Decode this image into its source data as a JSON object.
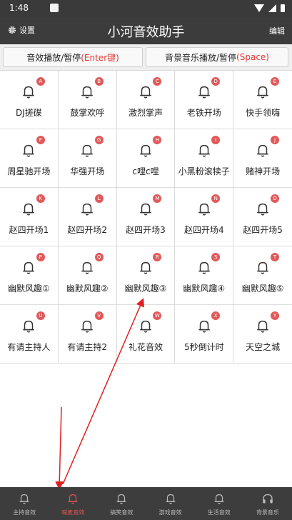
{
  "status_bar": {
    "time": "1:48"
  },
  "header": {
    "settings_label": "设置",
    "title": "小河音效助手",
    "edit_label": "编辑"
  },
  "top_buttons": {
    "left": {
      "text": "音效播放/暂停",
      "key": "(Enter键)"
    },
    "right": {
      "text": "背景音乐播放/暂停",
      "key": "(Space)"
    }
  },
  "grid": {
    "rows": [
      [
        {
          "label": "DJ搓碟",
          "badge": "A"
        },
        {
          "label": "鼓掌欢呼",
          "badge": "B"
        },
        {
          "label": "激烈掌声",
          "badge": "C"
        },
        {
          "label": "老铁开场",
          "badge": "D"
        },
        {
          "label": "快手领嗨",
          "badge": "E"
        }
      ],
      [
        {
          "label": "周星驰开场",
          "badge": "F"
        },
        {
          "label": "华强开场",
          "badge": "G"
        },
        {
          "label": "c哩c哩",
          "badge": "H"
        },
        {
          "label": "小黑粉滚犊子",
          "badge": "I"
        },
        {
          "label": "赌神开场",
          "badge": "J"
        }
      ],
      [
        {
          "label": "赵四开场1",
          "badge": "K"
        },
        {
          "label": "赵四开场2",
          "badge": "L"
        },
        {
          "label": "赵四开场3",
          "badge": "M"
        },
        {
          "label": "赵四开场4",
          "badge": "N"
        },
        {
          "label": "赵四开场5",
          "badge": "O"
        }
      ],
      [
        {
          "label": "幽默风趣①",
          "badge": "P"
        },
        {
          "label": "幽默风趣②",
          "badge": "Q"
        },
        {
          "label": "幽默风趣③",
          "badge": "R"
        },
        {
          "label": "幽默风趣④",
          "badge": "S"
        },
        {
          "label": "幽默风趣⑤",
          "badge": "T"
        }
      ],
      [
        {
          "label": "有请主持人",
          "badge": "U"
        },
        {
          "label": "有请主持2",
          "badge": "V"
        },
        {
          "label": "礼花音效",
          "badge": "W"
        },
        {
          "label": "5秒倒计时",
          "badge": "X"
        },
        {
          "label": "天空之城",
          "badge": "Y"
        }
      ]
    ]
  },
  "bottom_nav": {
    "items": [
      {
        "label": "主持音效",
        "icon": "bell-icon",
        "active": false
      },
      {
        "label": "喊麦音效",
        "icon": "bell-icon",
        "active": true
      },
      {
        "label": "搞笑音效",
        "icon": "bell-icon",
        "active": false
      },
      {
        "label": "游戏音效",
        "icon": "bell-icon",
        "active": false
      },
      {
        "label": "生活音效",
        "icon": "bell-icon",
        "active": false
      },
      {
        "label": "背景音乐",
        "icon": "headphones-icon",
        "active": false
      }
    ]
  },
  "colors": {
    "accent": "#e05555",
    "header_bg": "#3c3c3c",
    "badge": "#e05a5a"
  }
}
